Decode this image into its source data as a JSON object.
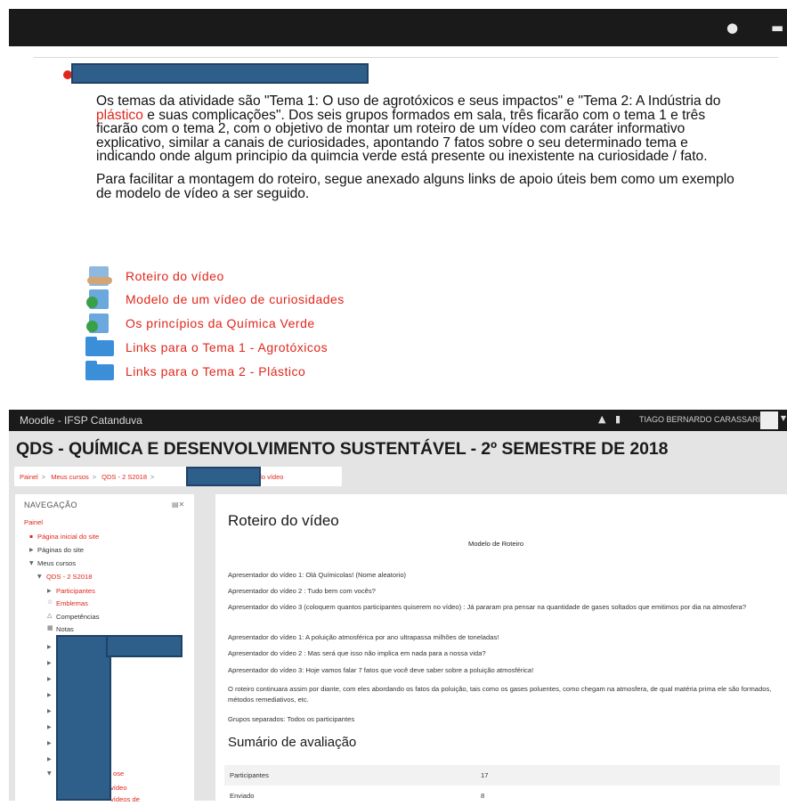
{
  "top": {
    "paragraphs": [
      {
        "before": "Os temas da atividade são \"Tema 1: O uso de agrotóxicos e seus impactos\" e \"Tema 2: A Indústria do ",
        "highlight": "plástico",
        "after": " e suas complicações\". Dos seis grupos formados em sala, três ficarão com o tema 1 e três ficarão com o tema 2, com o objetivo de montar um roteiro de um vídeo com caráter informativo explicativo, similar a canais de curiosidades, apontando 7 fatos sobre o seu determinado tema e indicando onde algum principio da quimcia verde está presente ou inexistente na curiosidade / fato."
      },
      {
        "text": "Para facilitar a montagem do roteiro, segue anexado alguns links de apoio úteis bem como um exemplo de modelo de vídeo a ser seguido."
      }
    ],
    "resources": [
      {
        "label": "Roteiro do vídeo",
        "icon": "assignment-icon"
      },
      {
        "label": "Modelo de um vídeo de curiosidades",
        "icon": "url-link-icon"
      },
      {
        "label": "Os princípios da Química Verde",
        "icon": "url-link-icon"
      },
      {
        "label": "Links para o Tema 1 - Agrotóxicos",
        "icon": "folder-icon"
      },
      {
        "label": "Links para o Tema 2 - Plástico",
        "icon": "folder-icon"
      }
    ]
  },
  "moodle": {
    "site_name": "Moodle - IFSP Catanduva",
    "user_name": "TIAGO BERNARDO CARASSARI",
    "course_title": "QDS - QUÍMICA E DESENVOLVIMENTO SUSTENTÁVEL - 2º SEMESTRE DE 2018",
    "breadcrumb": [
      "Painel",
      "Meus cursos",
      "QDS - 2 S2018",
      "Roteiro do vídeo"
    ],
    "nav": {
      "title": "NAVEGAÇÃO",
      "items": {
        "painel": "Painel",
        "pagina_inicial": "Página inicial do site",
        "paginas": "Páginas do site",
        "meus_cursos": "Meus cursos",
        "curso": "QDS - 2 S2018",
        "participantes": "Participantes",
        "emblemas": "Emblemas",
        "competencias": "Competências",
        "notas": "Notas",
        "frag1": "ose",
        "frag2": "vídeo",
        "frag3": "vídeos de"
      }
    },
    "main": {
      "heading": "Roteiro do vídeo",
      "model_title": "Modelo de Roteiro",
      "lines": [
        "Apresentador do vídeo 1: Olá Químicolas! (Nome aleatorio)",
        "Apresentador do vídeo 2 : Tudo bem com vocês?",
        "Apresentador do vídeo 3 (coloquem quantos participantes quiserem no vídeo) : Já pararam pra pensar na quantidade de gases soltados que emitimos por dia na atmosfera?",
        "Apresentador do vídeo 1: A poluição atmosférica por ano ultrapassa milhões de toneladas!",
        "Apresentador do vídeo 2 : Mas será que isso não implica em nada para a nossa vida?",
        "Apresentador do vídeo 3: Hoje vamos falar 7 fatos que você deve saber sobre a poluição atmosférica!",
        "O roteiro continuara assim por diante, com eles abordando os fatos da poluição, tais como os gases poluentes, como chegam na atmosfera, de qual matéria prima ele são formados, métodos remediativos, etc.",
        "Grupos separados: Todos os participantes"
      ],
      "summary_heading": "Sumário de avaliação",
      "summary_rows": [
        {
          "label": "Participantes",
          "value": "17"
        },
        {
          "label": "Enviado",
          "value": "8"
        }
      ]
    }
  },
  "colors": {
    "accent": "#e0261b",
    "navbar": "#1a1a1a",
    "redaction": "#2e5e8a",
    "folder": "#3b8fd9"
  }
}
